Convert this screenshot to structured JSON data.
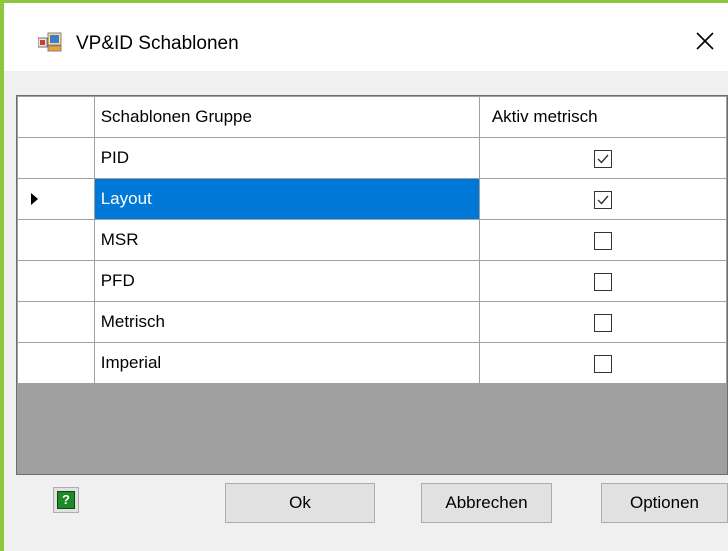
{
  "window": {
    "title": "VP&ID Schablonen",
    "close_glyph": "✕"
  },
  "grid": {
    "columns": [
      "Schablonen Gruppe",
      "Aktiv metrisch"
    ],
    "rows": [
      {
        "name": "PID",
        "checked": true,
        "selected": false,
        "current": false
      },
      {
        "name": "Layout",
        "checked": true,
        "selected": true,
        "current": true
      },
      {
        "name": "MSR",
        "checked": false,
        "selected": false,
        "current": false
      },
      {
        "name": "PFD",
        "checked": false,
        "selected": false,
        "current": false
      },
      {
        "name": "Metrisch",
        "checked": false,
        "selected": false,
        "current": false
      },
      {
        "name": "Imperial",
        "checked": false,
        "selected": false,
        "current": false
      }
    ]
  },
  "buttons": {
    "help_glyph": "?",
    "ok_label": "Ok",
    "cancel_label": "Abbrechen",
    "options_label": "Optionen"
  },
  "colors": {
    "accent_border": "#8dc63f",
    "selection": "#0078d7"
  },
  "icons": {
    "app": "template-window-icon",
    "help": "help-icon"
  }
}
